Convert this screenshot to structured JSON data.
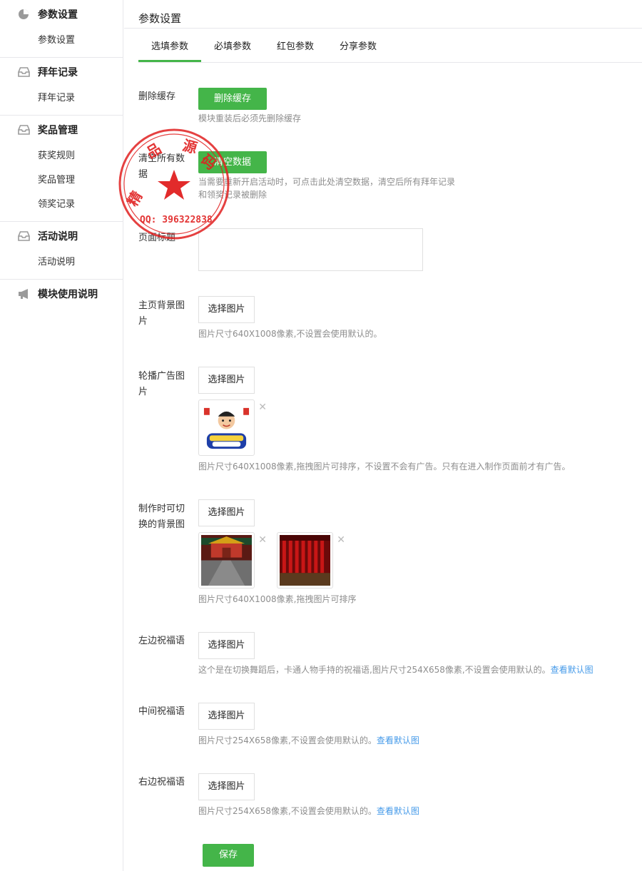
{
  "sidebar": {
    "groups": [
      {
        "title": "参数设置",
        "icon": "pie-chart-icon",
        "items": [
          "参数设置"
        ]
      },
      {
        "title": "拜年记录",
        "icon": "inbox-icon",
        "items": [
          "拜年记录"
        ]
      },
      {
        "title": "奖品管理",
        "icon": "inbox-icon",
        "items": [
          "获奖规则",
          "奖品管理",
          "领奖记录"
        ]
      },
      {
        "title": "活动说明",
        "icon": "inbox-icon",
        "items": [
          "活动说明"
        ]
      },
      {
        "title": "模块使用说明",
        "icon": "megaphone-icon",
        "items": []
      }
    ]
  },
  "page": {
    "title": "参数设置"
  },
  "tabs": [
    "选填参数",
    "必填参数",
    "红包参数",
    "分享参数"
  ],
  "form": {
    "cache": {
      "label": "删除缓存",
      "button": "删除缓存",
      "hint": "模块重装后必须先删除缓存"
    },
    "clear": {
      "label": "清空所有数据",
      "button": "清空数据",
      "hint1": "当需要重新开启活动时，可点击此处清空数据，清空后所有拜年记录",
      "hint2": "和领奖记录被删除"
    },
    "title": {
      "label": "页面标题",
      "value": ""
    },
    "bg": {
      "label": "主页背景图片",
      "button": "选择图片",
      "hint": "图片尺寸640X1008像素,不设置会使用默认的。"
    },
    "ad": {
      "label": "轮播广告图片",
      "button": "选择图片",
      "hint": "图片尺寸640X1008像素,拖拽图片可排序，不设置不会有广告。只有在进入制作页面前才有广告。"
    },
    "switch": {
      "label": "制作时可切换的背景图",
      "button": "选择图片",
      "hint": "图片尺寸640X1008像素,拖拽图片可排序"
    },
    "left": {
      "label": "左边祝福语",
      "button": "选择图片",
      "hint": "这个是在切换舞蹈后，卡通人物手持的祝福语,图片尺寸254X658像素,不设置会使用默认的。",
      "link": "查看默认图"
    },
    "middle": {
      "label": "中间祝福语",
      "button": "选择图片",
      "hint": "图片尺寸254X658像素,不设置会使用默认的。",
      "link": "查看默认图"
    },
    "right": {
      "label": "右边祝福语",
      "button": "选择图片",
      "hint": "图片尺寸254X658像素,不设置会使用默认的。",
      "link": "查看默认图"
    },
    "save": "保存"
  },
  "stamp": {
    "text": "精品源码",
    "qq": "QQ: 396322838"
  },
  "colors": {
    "accent": "#44b549",
    "link": "#459ae9",
    "stamp": "#e02020"
  }
}
